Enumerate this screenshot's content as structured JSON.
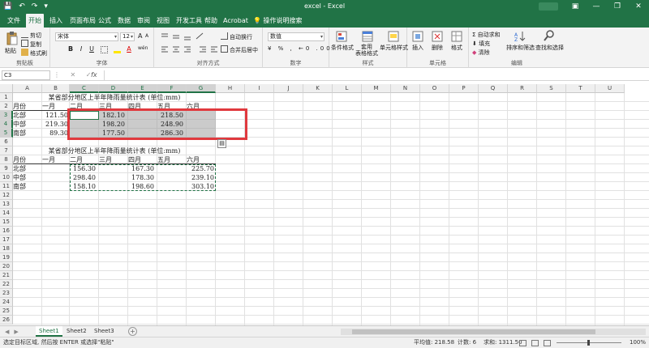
{
  "window": {
    "title": "excel - Excel",
    "controls": {
      "min": "—",
      "restore": "❐",
      "close": "✕",
      "ribbon_opt": "▣"
    },
    "qa": {
      "save": "💾",
      "undo": "↶",
      "redo": "↷",
      "more": "▾"
    }
  },
  "tabs": [
    "文件",
    "开始",
    "插入",
    "页面布局",
    "公式",
    "数据",
    "审阅",
    "视图",
    "开发工具",
    "帮助",
    "Acrobat"
  ],
  "active_tab": "开始",
  "tell_me": "操作说明搜索",
  "ribbon": {
    "clipboard": {
      "paste": "粘贴",
      "cut": "剪切",
      "copy": "复制",
      "painter": "格式刷",
      "label": "剪贴板"
    },
    "font": {
      "name": "宋体",
      "size": "12",
      "label": "字体",
      "bold": "B",
      "italic": "I",
      "underline": "U",
      "grow": "A",
      "shrink": "A",
      "wen": "wén"
    },
    "align": {
      "wrap": "自动换行",
      "merge": "合并后居中",
      "label": "对齐方式"
    },
    "number": {
      "format": "数值",
      "label": "数字"
    },
    "styles": {
      "cond": "条件格式",
      "table": "套用\n表格格式",
      "cell": "单元格样式",
      "label": "样式"
    },
    "cells": {
      "insert": "插入",
      "delete": "删除",
      "format": "格式",
      "label": "单元格"
    },
    "editing": {
      "sum": "自动求和",
      "fill": "填充",
      "clear": "清除",
      "sort": "排序和筛选",
      "find": "查找和选择",
      "label": "编辑"
    }
  },
  "formula_bar": {
    "name_box": "C3",
    "fx": "fx",
    "formula": ""
  },
  "columns": [
    "A",
    "B",
    "C",
    "D",
    "E",
    "F",
    "G",
    "H",
    "I",
    "J",
    "K",
    "L",
    "M",
    "N",
    "O",
    "P",
    "Q",
    "R",
    "S",
    "T",
    "U"
  ],
  "rows": [
    "1",
    "2",
    "3",
    "4",
    "5",
    "6",
    "7",
    "8",
    "9",
    "10",
    "11",
    "12",
    "13",
    "14",
    "15",
    "16",
    "17",
    "18",
    "19",
    "20",
    "21",
    "22",
    "23",
    "24",
    "25",
    "26"
  ],
  "sheet": {
    "title1": "某省部分地区上半年降雨量统计表 (单位:mm)",
    "title2": "某省部分地区上半年降雨量统计表 (单位:mm)",
    "header1": [
      "月份",
      "一月",
      "二月",
      "三月",
      "四月",
      "五月",
      "六月"
    ],
    "header2": [
      "月份",
      "一月",
      "二月",
      "三月",
      "四月",
      "五月",
      "六月"
    ],
    "t1_rows": [
      {
        "region": "北部",
        "jan": "121.50",
        "mar": "182.10",
        "may": "218.50"
      },
      {
        "region": "中部",
        "jan": "219.30",
        "mar": "198.20",
        "may": "248.90"
      },
      {
        "region": "南部",
        "jan": "89.30",
        "mar": "177.50",
        "may": "286.30"
      }
    ],
    "t2_rows": [
      {
        "region": "北部",
        "feb": "156.30",
        "apr": "167.30",
        "jun": "225.70"
      },
      {
        "region": "中部",
        "feb": "298.40",
        "apr": "178.30",
        "jun": "239.10"
      },
      {
        "region": "南部",
        "feb": "158.10",
        "apr": "198.60",
        "jun": "303.10"
      }
    ]
  },
  "sheets": [
    "Sheet1",
    "Sheet2",
    "Sheet3"
  ],
  "active_sheet": "Sheet1",
  "status": {
    "message": "选定目标区域, 然后按 ENTER 或选择\"粘贴\"",
    "avg": "平均值: 218.58",
    "count": "计数: 6",
    "sum": "求和: 1311.50",
    "zoom": "100%"
  }
}
